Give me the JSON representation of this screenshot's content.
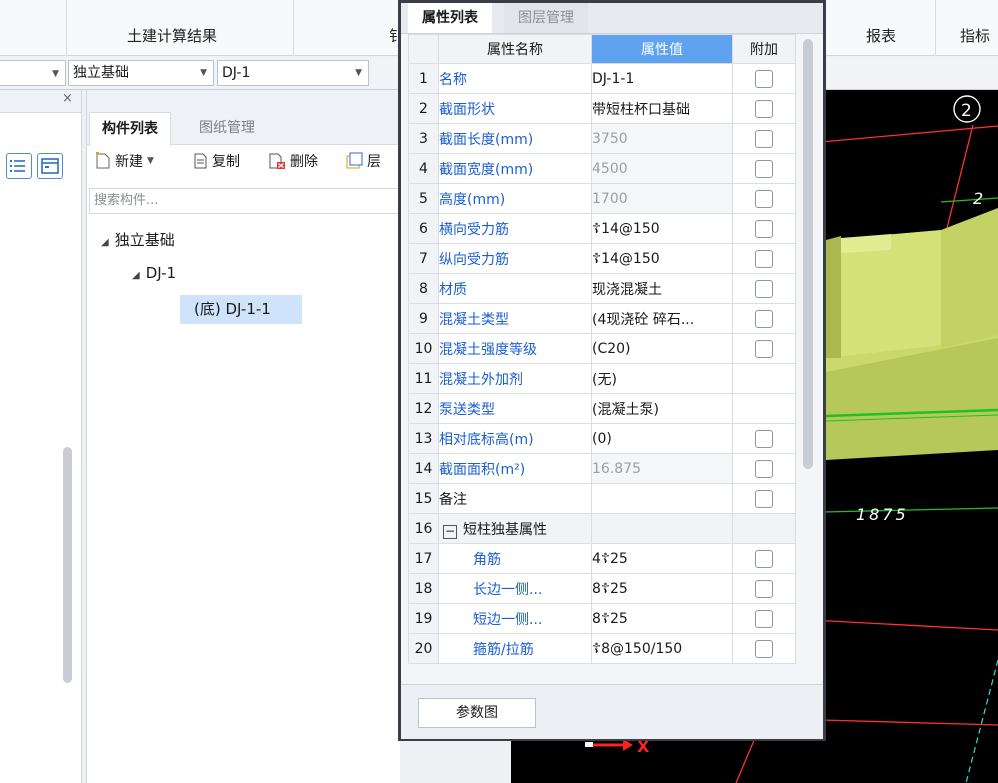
{
  "ribbon": {
    "tab_calc_results": "土建计算结果",
    "tab_rebar_partial": "钅",
    "tab_report": "报表",
    "tab_index_partial": "指标"
  },
  "selectors": {
    "type_value": "独立基础",
    "name_value": "DJ-1"
  },
  "component_panel": {
    "tab_list": "构件列表",
    "tab_drawing": "图纸管理",
    "btn_new": "新建",
    "btn_copy": "复制",
    "btn_delete": "删除",
    "btn_layer_partial": "层",
    "search_placeholder": "搜索构件...",
    "tree": {
      "root": "独立基础",
      "child": "DJ-1",
      "leaf": "(底) DJ-1-1"
    }
  },
  "properties_panel": {
    "tab_props": "属性列表",
    "tab_layers": "图层管理",
    "col_name": "属性名称",
    "col_value": "属性值",
    "col_extra": "附加",
    "footer_button": "参数图",
    "rows": [
      {
        "n": "1",
        "name": "名称",
        "value": "DJ-1-1"
      },
      {
        "n": "2",
        "name": "截面形状",
        "value": "带短柱杯口基础"
      },
      {
        "n": "3",
        "name": "截面长度(mm)",
        "value": "3750"
      },
      {
        "n": "4",
        "name": "截面宽度(mm)",
        "value": "4500"
      },
      {
        "n": "5",
        "name": "高度(mm)",
        "value": "1700"
      },
      {
        "n": "6",
        "name": "横向受力筋",
        "value": "☦14@150"
      },
      {
        "n": "7",
        "name": "纵向受力筋",
        "value": "☦14@150"
      },
      {
        "n": "8",
        "name": "材质",
        "value": "现浇混凝土"
      },
      {
        "n": "9",
        "name": "混凝土类型",
        "value": "(4现浇砼 碎石..."
      },
      {
        "n": "10",
        "name": "混凝土强度等级",
        "value": "(C20)"
      },
      {
        "n": "11",
        "name": "混凝土外加剂",
        "value": "(无)"
      },
      {
        "n": "12",
        "name": "泵送类型",
        "value": "(混凝土泵)"
      },
      {
        "n": "13",
        "name": "相对底标高(m)",
        "value": "(0)"
      },
      {
        "n": "14",
        "name": "截面面积(m²)",
        "value": "16.875"
      },
      {
        "n": "15",
        "name": "备注",
        "value": ""
      },
      {
        "n": "16",
        "name": "短柱独基属性",
        "value": ""
      },
      {
        "n": "17",
        "name": "角筋",
        "value": "4☦25"
      },
      {
        "n": "18",
        "name": "长边一侧...",
        "value": "8☦25"
      },
      {
        "n": "19",
        "name": "短边一侧...",
        "value": "8☦25"
      },
      {
        "n": "20",
        "name": "箍筋/拉筋",
        "value": "☦8@150/150"
      }
    ]
  },
  "viewport": {
    "axis_label": "2",
    "dim_top": "2",
    "dim_bottom": "1875",
    "axis_x": "X"
  },
  "colors": {
    "accent": "#5ea2f0",
    "link_blue": "#1b5fd1",
    "model_green": "#c5d86a"
  }
}
